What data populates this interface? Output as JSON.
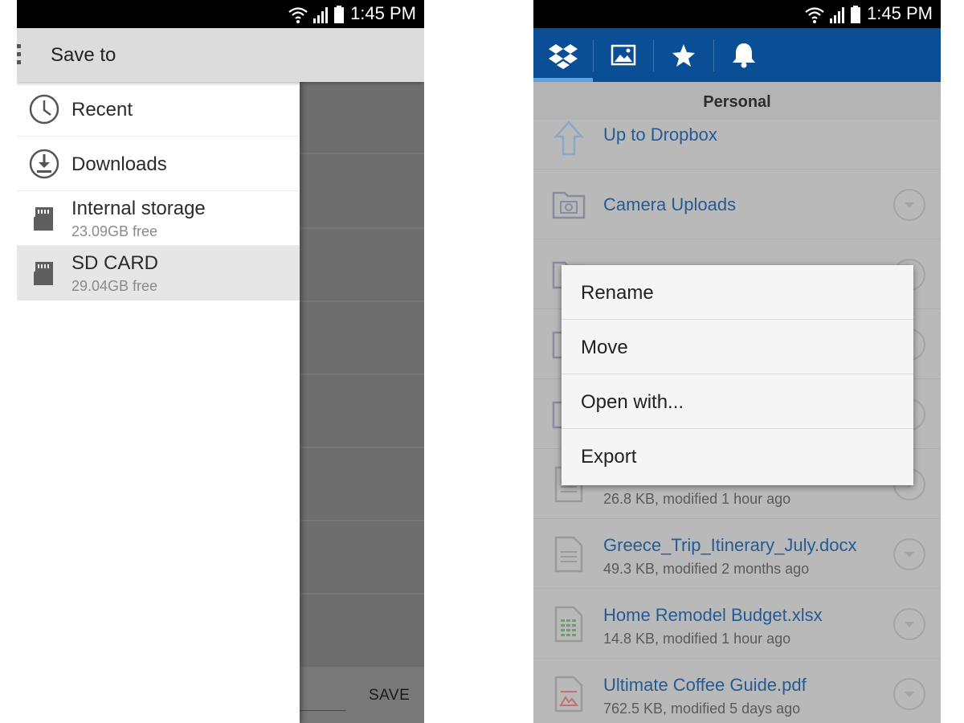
{
  "status_bar": {
    "time": "1:45 PM"
  },
  "left_screen": {
    "appbar": {
      "title": "Save to"
    },
    "drawer_items": [
      {
        "label": "Recent",
        "icon": "clock-icon"
      },
      {
        "label": "Downloads",
        "icon": "download-icon"
      },
      {
        "label": "Internal storage",
        "sub": "23.09GB free",
        "icon": "sd-card-icon"
      },
      {
        "label": "SD CARD",
        "sub": "29.04GB free",
        "icon": "sd-card-icon",
        "selected": true
      }
    ],
    "save_label": "SAVE"
  },
  "right_screen": {
    "tabs": [
      {
        "icon": "dropbox-icon",
        "active": true
      },
      {
        "icon": "photos-icon"
      },
      {
        "icon": "star-icon"
      },
      {
        "icon": "bell-icon"
      }
    ],
    "section_title": "Personal",
    "files": [
      {
        "name": "Up to Dropbox",
        "icon": "up-arrow-icon"
      },
      {
        "name": "Camera Uploads",
        "icon": "camera-folder-icon"
      },
      {
        "name": "",
        "icon": "folder-icon"
      },
      {
        "name": "",
        "icon": "folder-icon"
      },
      {
        "name": "",
        "icon": "folder-icon"
      },
      {
        "name": "",
        "meta": "26.8 KB, modified 1 hour ago",
        "icon": "document-icon"
      },
      {
        "name": "Greece_Trip_Itinerary_July.docx",
        "meta": "49.3 KB, modified 2 months ago",
        "icon": "document-icon"
      },
      {
        "name": "Home Remodel Budget.xlsx",
        "meta": "14.8 KB, modified 1 hour ago",
        "icon": "spreadsheet-icon"
      },
      {
        "name": "Ultimate Coffee Guide.pdf",
        "meta": "762.5 KB, modified 5 days ago",
        "icon": "pdf-icon"
      }
    ],
    "context_menu": [
      {
        "label": "Rename"
      },
      {
        "label": "Move"
      },
      {
        "label": "Open with..."
      },
      {
        "label": "Export"
      }
    ]
  },
  "colors": {
    "dropbox_blue": "#0a4f96",
    "tab_indicator": "#5aa3e6",
    "link_blue": "#265a93"
  }
}
